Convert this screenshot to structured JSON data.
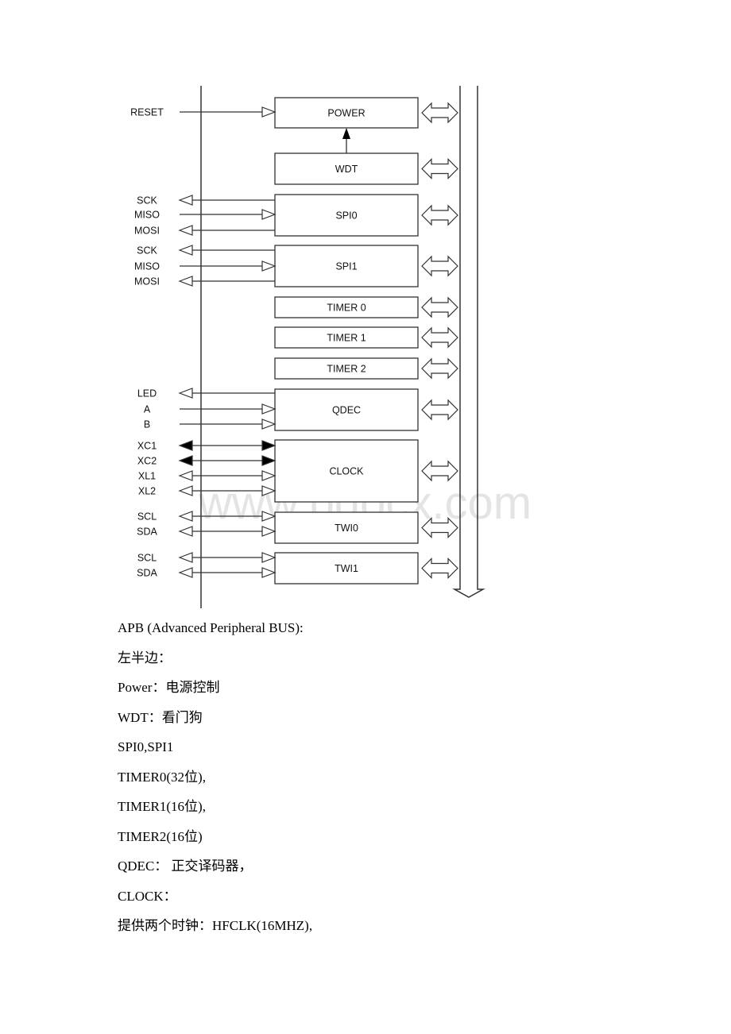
{
  "diagram": {
    "blocks": [
      {
        "label": "POWER"
      },
      {
        "label": "WDT"
      },
      {
        "label": "SPI0"
      },
      {
        "label": "SPI1"
      },
      {
        "label": "TIMER 0"
      },
      {
        "label": "TIMER 1"
      },
      {
        "label": "TIMER 2"
      },
      {
        "label": "QDEC"
      },
      {
        "label": "CLOCK"
      },
      {
        "label": "TWI0"
      },
      {
        "label": "TWI1"
      }
    ],
    "signals": [
      {
        "label": "RESET",
        "direction": "in"
      },
      {
        "label": "SCK",
        "direction": "out"
      },
      {
        "label": "MISO",
        "direction": "in"
      },
      {
        "label": "MOSI",
        "direction": "out"
      },
      {
        "label": "SCK",
        "direction": "out"
      },
      {
        "label": "MISO",
        "direction": "in"
      },
      {
        "label": "MOSI",
        "direction": "out"
      },
      {
        "label": "LED",
        "direction": "out"
      },
      {
        "label": "A",
        "direction": "in"
      },
      {
        "label": "B",
        "direction": "in"
      },
      {
        "label": "XC1",
        "direction": "bidir-filled"
      },
      {
        "label": "XC2",
        "direction": "bidir-filled"
      },
      {
        "label": "XL1",
        "direction": "bidir"
      },
      {
        "label": "XL2",
        "direction": "bidir"
      },
      {
        "label": "SCL",
        "direction": "bidir"
      },
      {
        "label": "SDA",
        "direction": "bidir"
      },
      {
        "label": "SCL",
        "direction": "bidir"
      },
      {
        "label": "SDA",
        "direction": "bidir"
      }
    ],
    "watermark": "www.bdocx.com"
  },
  "text": {
    "lines": [
      "APB (Advanced Peripheral BUS):",
      "左半边：",
      "Power：电源控制",
      "WDT：看门狗",
      "SPI0,SPI1",
      "TIMER0(32位),",
      "TIMER1(16位),",
      "TIMER2(16位)",
      "QDEC： 正交译码器，",
      "CLOCK：",
      "提供两个时钟：HFCLK(16MHZ),"
    ]
  }
}
